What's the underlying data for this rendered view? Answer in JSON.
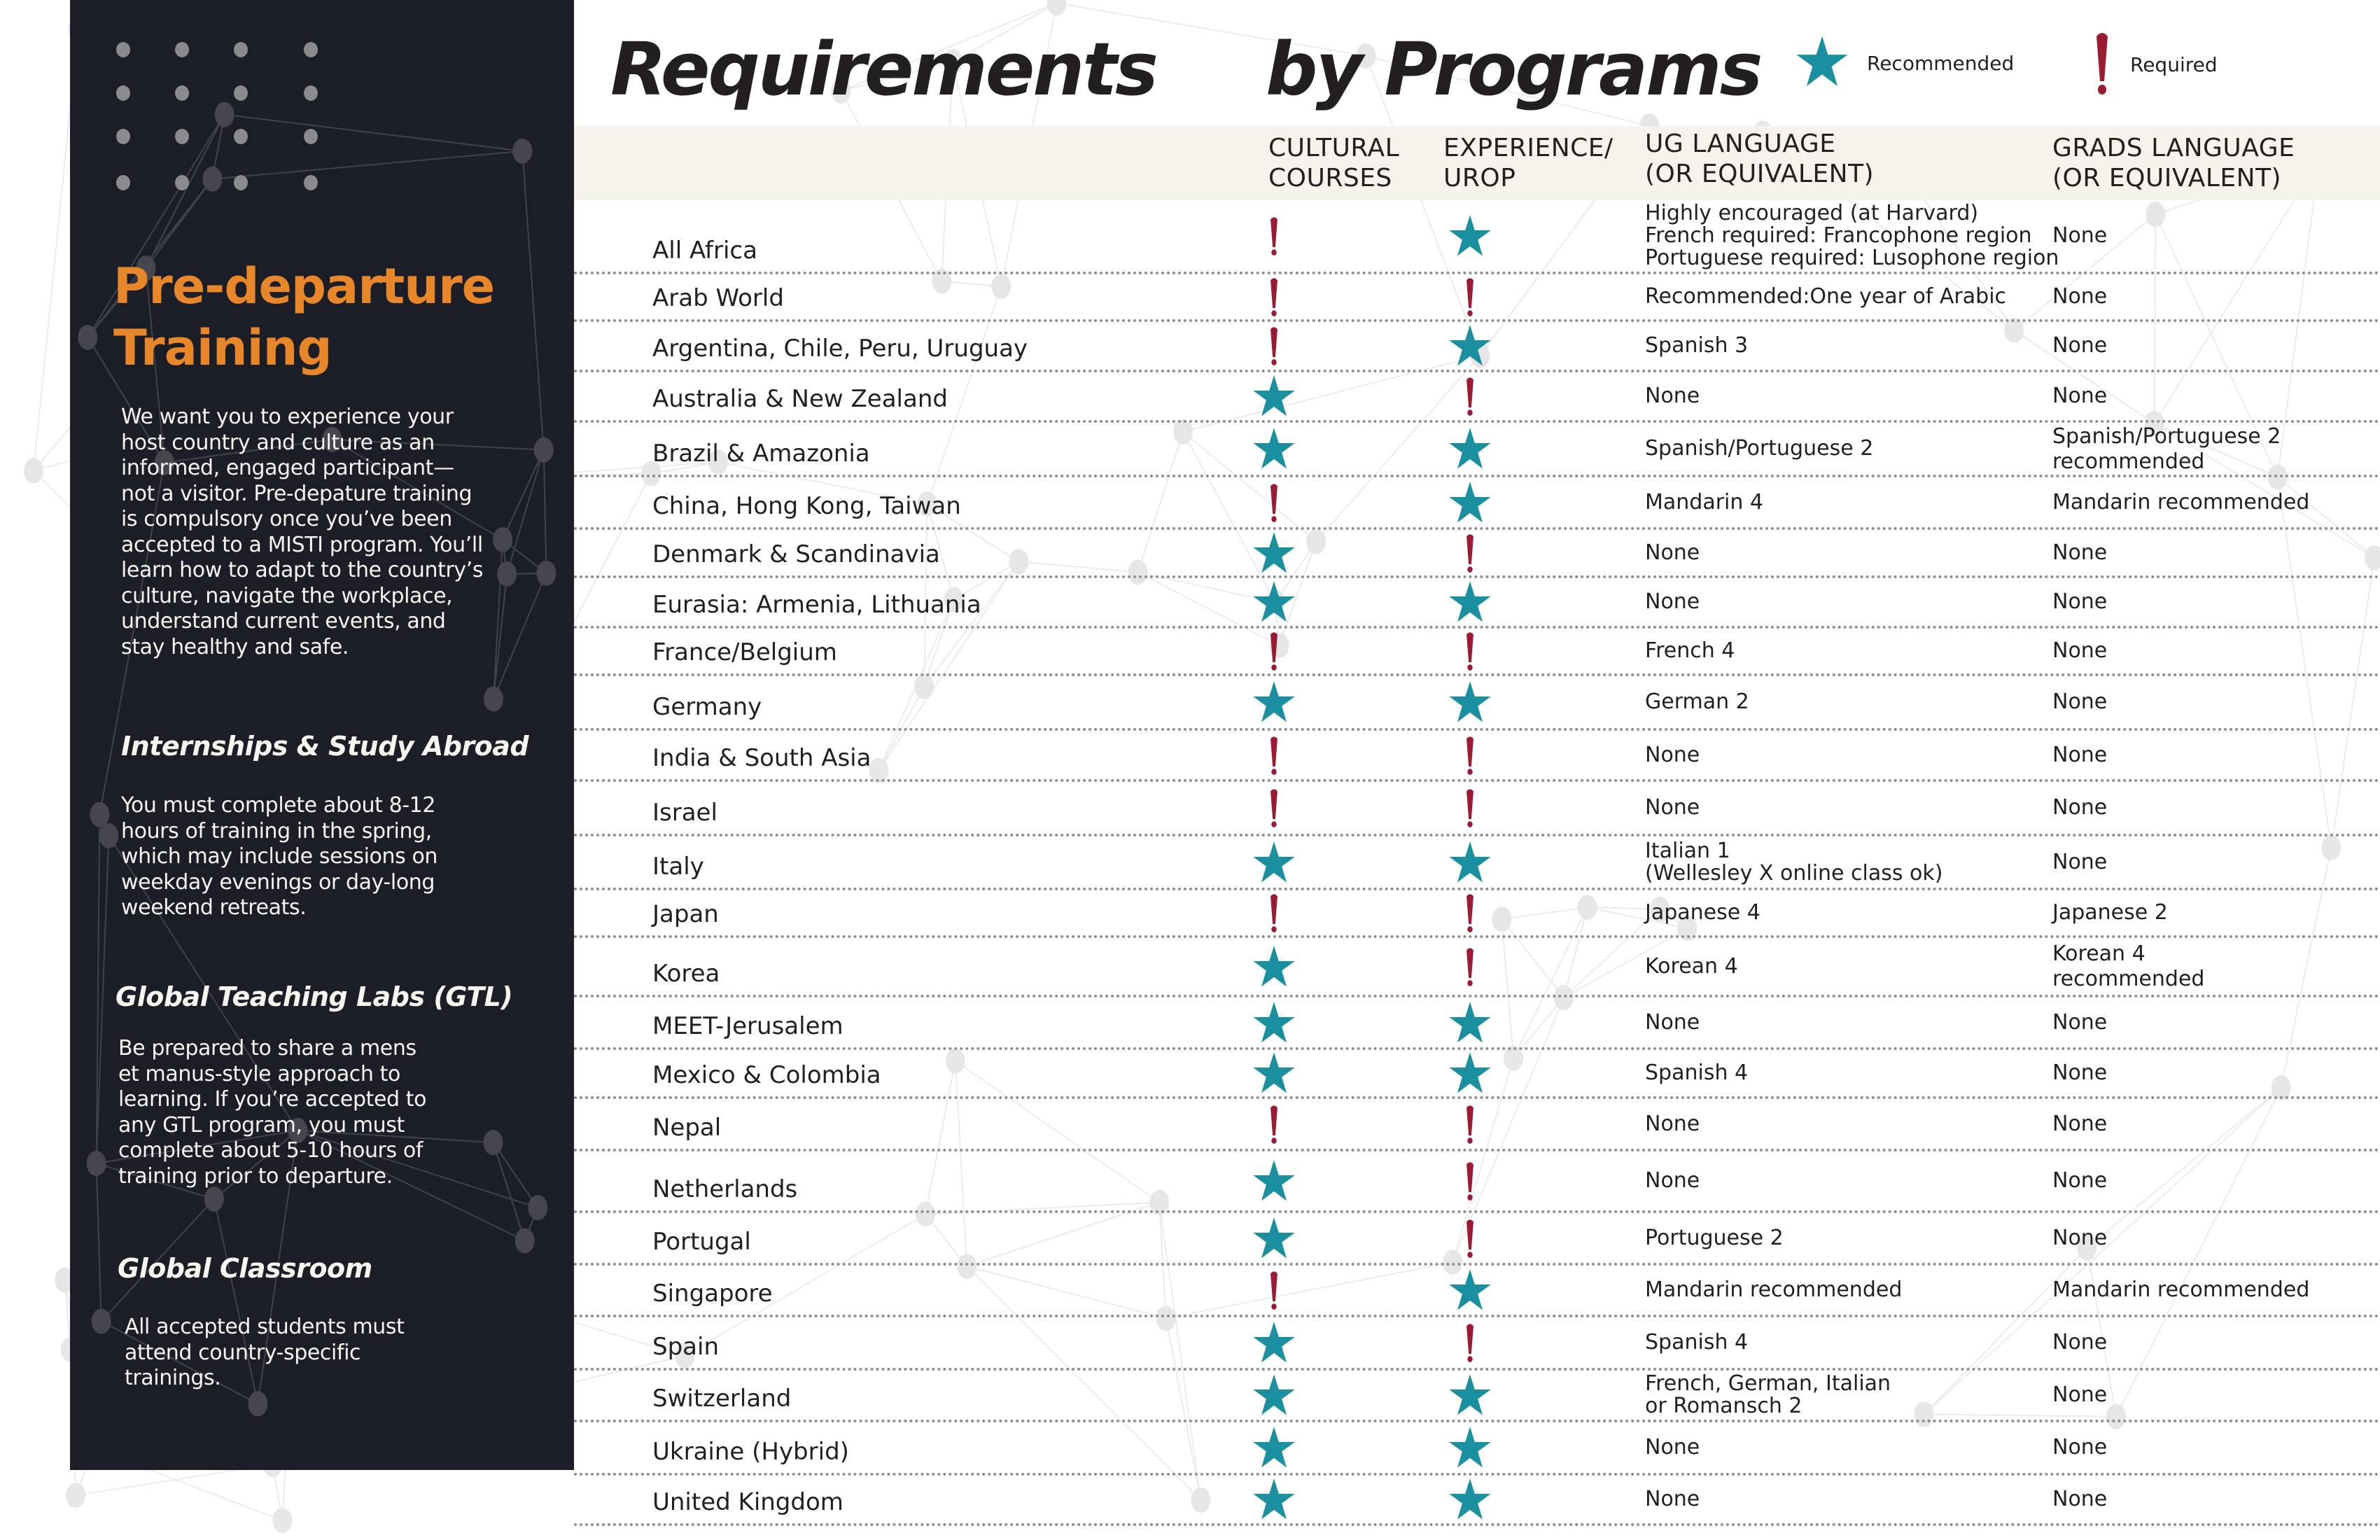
{
  "sidebar": {
    "title": "Pre-departure\nTraining",
    "title_line1": "Pre-departure",
    "title_line2": "Training",
    "intro": "We want you to experience your\nhost country and culture as an\ninformed, engaged participant—\nnot a visitor. Pre-depature training\nis compulsory once you’ve been\naccepted to a MISTI program. You’ll\nlearn how to adapt to the country’s\nculture, navigate the workplace,\nunderstand current events, and\nstay healthy and safe.",
    "sections": [
      {
        "heading": "Internships & Study Abroad",
        "body": "You must complete about 8-12\nhours of training in the spring,\nwhich may include sessions on\nweekday evenings or day-long\nweekend retreats."
      },
      {
        "heading": "Global Teaching Labs (GTL)",
        "body": "Be prepared to share a mens\net manus-style approach to\nlearning. If you’re accepted to\nany GTL program, you must\ncomplete about 5-10 hours of\ntraining prior to departure."
      },
      {
        "heading": "Global Classroom",
        "body": "All accepted students must\nattend country-specific\ntrainings."
      }
    ]
  },
  "header": {
    "title_part1": "Requirements",
    "title_part2": "by Programs",
    "legend": [
      {
        "icon": "star-icon",
        "label": "Recommended",
        "value": "recommended"
      },
      {
        "icon": "exclamation-icon",
        "label": "Required",
        "value": "required"
      }
    ]
  },
  "colors": {
    "sidebar_bg": "#1c1e27",
    "accent_orange": "#e8862a",
    "recommended_teal": "#1a8fa0",
    "required_red": "#9b1c32",
    "header_band": "#f6f2ec",
    "text": "#231f20"
  },
  "table": {
    "columns": [
      {
        "key": "country",
        "label": ""
      },
      {
        "key": "cultural",
        "label": "CULTURAL\nCOURSES"
      },
      {
        "key": "experience",
        "label": "EXPERIENCE/\nUROP"
      },
      {
        "key": "ug",
        "label": "UG LANGUAGE\n(OR EQUIVALENT)"
      },
      {
        "key": "grad",
        "label": "GRADS LANGUAGE\n(OR EQUIVALENT)"
      }
    ],
    "rows": [
      {
        "country": "All Africa",
        "cultural": "required",
        "experience": "recommended",
        "ug": "Highly encouraged (at Harvard)\nFrench required: Francophone region\nPortuguese required: Lusophone region",
        "grad": "None"
      },
      {
        "country": "Arab World",
        "cultural": "required",
        "experience": "required",
        "ug": "Recommended:One year of Arabic",
        "grad": "None"
      },
      {
        "country": "Argentina, Chile, Peru, Uruguay",
        "cultural": "required",
        "experience": "recommended",
        "ug": "Spanish 3",
        "grad": "None"
      },
      {
        "country": "Australia & New Zealand",
        "cultural": "recommended",
        "experience": "required",
        "ug": "None",
        "grad": "None"
      },
      {
        "country": "Brazil & Amazonia",
        "cultural": "recommended",
        "experience": "recommended",
        "ug": "Spanish/Portuguese 2",
        "grad": "Spanish/Portuguese 2\nrecommended"
      },
      {
        "country": "China, Hong Kong, Taiwan",
        "cultural": "required",
        "experience": "recommended",
        "ug": "Mandarin 4",
        "grad": "Mandarin recommended"
      },
      {
        "country": "Denmark & Scandinavia",
        "cultural": "recommended",
        "experience": "required",
        "ug": "None",
        "grad": "None"
      },
      {
        "country": "Eurasia: Armenia, Lithuania",
        "cultural": "recommended",
        "experience": "recommended",
        "ug": "None",
        "grad": "None"
      },
      {
        "country": "France/Belgium",
        "cultural": "required",
        "experience": "required",
        "ug": "French 4",
        "grad": "None"
      },
      {
        "country": "Germany",
        "cultural": "recommended",
        "experience": "recommended",
        "ug": "German 2",
        "grad": "None"
      },
      {
        "country": "India & South Asia",
        "cultural": "required",
        "experience": "required",
        "ug": "None",
        "grad": "None"
      },
      {
        "country": "Israel",
        "cultural": "required",
        "experience": "required",
        "ug": "None",
        "grad": "None"
      },
      {
        "country": "Italy",
        "cultural": "recommended",
        "experience": "recommended",
        "ug": "Italian 1\n(Wellesley X online class ok)",
        "grad": "None"
      },
      {
        "country": "Japan",
        "cultural": "required",
        "experience": "required",
        "ug": "Japanese 4",
        "grad": "Japanese 2"
      },
      {
        "country": "Korea",
        "cultural": "recommended",
        "experience": "required",
        "ug": "Korean 4",
        "grad": "Korean 4\nrecommended"
      },
      {
        "country": "MEET-Jerusalem",
        "cultural": "recommended",
        "experience": "recommended",
        "ug": "None",
        "grad": "None"
      },
      {
        "country": "Mexico & Colombia",
        "cultural": "recommended",
        "experience": "recommended",
        "ug": "Spanish 4",
        "grad": "None"
      },
      {
        "country": "Nepal",
        "cultural": "required",
        "experience": "required",
        "ug": "None",
        "grad": "None"
      },
      {
        "country": "Netherlands",
        "cultural": "recommended",
        "experience": "required",
        "ug": "None",
        "grad": "None"
      },
      {
        "country": "Portugal",
        "cultural": "recommended",
        "experience": "required",
        "ug": "Portuguese 2",
        "grad": "None"
      },
      {
        "country": "Singapore",
        "cultural": "required",
        "experience": "recommended",
        "ug": "Mandarin recommended",
        "grad": "Mandarin recommended"
      },
      {
        "country": "Spain",
        "cultural": "recommended",
        "experience": "required",
        "ug": "Spanish 4",
        "grad": "None"
      },
      {
        "country": "Switzerland",
        "cultural": "recommended",
        "experience": "recommended",
        "ug": "French, German, Italian\nor Romansch 2",
        "grad": "None"
      },
      {
        "country": "Ukraine (Hybrid)",
        "cultural": "recommended",
        "experience": "recommended",
        "ug": "None",
        "grad": "None"
      },
      {
        "country": "United Kingdom",
        "cultural": "recommended",
        "experience": "recommended",
        "ug": "None",
        "grad": "None"
      }
    ]
  }
}
